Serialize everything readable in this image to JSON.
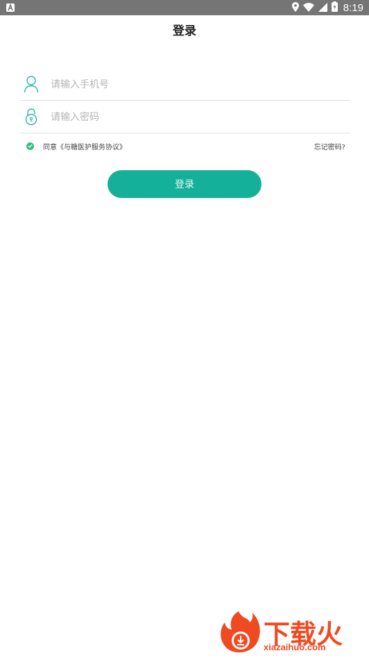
{
  "status_bar": {
    "time": "8:19"
  },
  "header": {
    "title": "登录"
  },
  "form": {
    "phone_placeholder": "请输入手机号",
    "password_placeholder": "请输入密码",
    "agreement_text": "同意《与糖医护服务协议》",
    "forgot_label": "忘记密码?",
    "login_label": "登录"
  },
  "watermark": {
    "brand": "下载火",
    "url": "xiazaihuo.com"
  },
  "colors": {
    "accent": "#14b099",
    "icon_teal": "#2ab3a3",
    "check_green": "#2ec07c",
    "watermark": "#f04a22"
  }
}
